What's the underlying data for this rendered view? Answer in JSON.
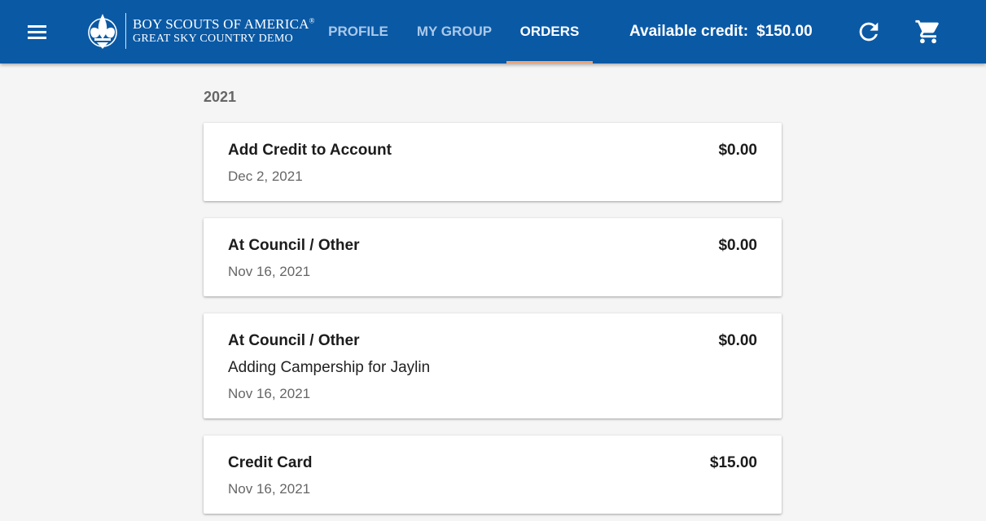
{
  "header": {
    "logo_line1": "BOY SCOUTS OF AMERICA",
    "logo_reg": "®",
    "logo_line2": "GREAT SKY COUNTRY DEMO",
    "tabs": [
      {
        "label": "PROFILE",
        "active": false
      },
      {
        "label": "MY GROUP",
        "active": false
      },
      {
        "label": "ORDERS",
        "active": true
      }
    ],
    "credit_label": "Available credit:",
    "credit_amount": "$150.00",
    "icons": {
      "menu": "menu-icon",
      "refresh": "refresh-icon",
      "cart": "cart-icon"
    }
  },
  "orders": {
    "year": "2021",
    "items": [
      {
        "title": "Add Credit to Account",
        "amount": "$0.00",
        "note": "",
        "date": "Dec 2, 2021"
      },
      {
        "title": "At Council / Other",
        "amount": "$0.00",
        "note": "",
        "date": "Nov 16, 2021"
      },
      {
        "title": "At Council / Other",
        "amount": "$0.00",
        "note": "Adding Campership for Jaylin",
        "date": "Nov 16, 2021"
      },
      {
        "title": "Credit Card",
        "amount": "$15.00",
        "note": "",
        "date": "Nov 16, 2021"
      }
    ]
  },
  "colors": {
    "appbar": "#0a59a5",
    "tab_inactive": "#aac9ea",
    "tab_indicator": "#e8a47a",
    "background": "#f5f5f5"
  }
}
